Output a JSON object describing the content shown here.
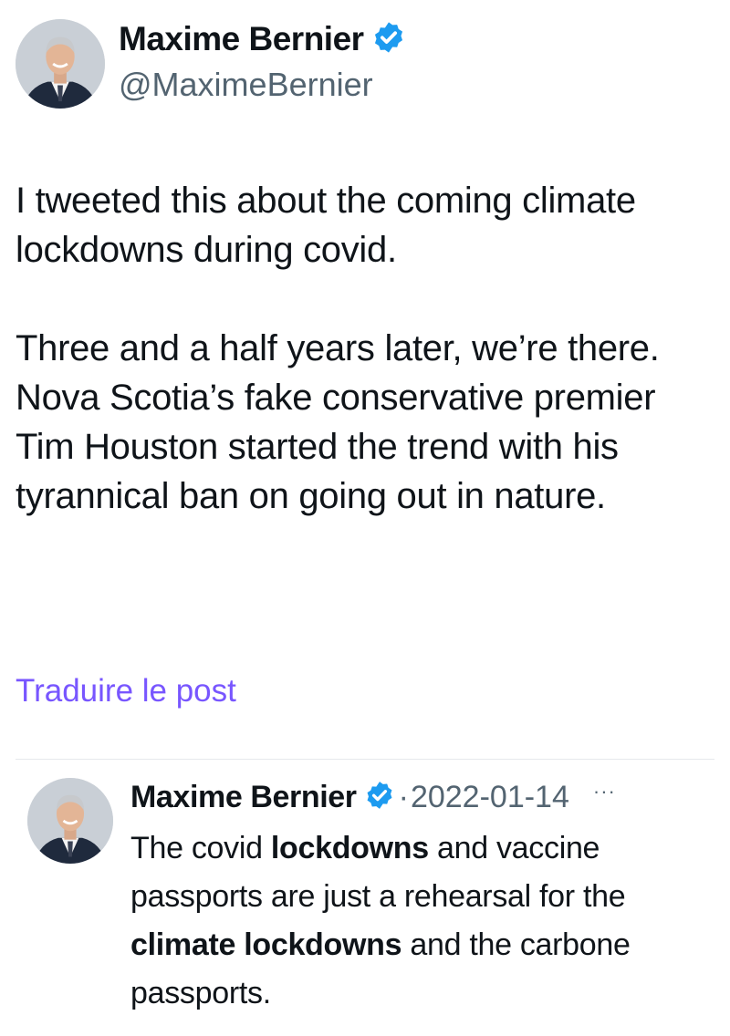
{
  "author": {
    "name": "Maxime Bernier",
    "handle": "@MaximeBernier",
    "verified_color": "#1d9bf0"
  },
  "tweet": {
    "paragraphs": [
      "I tweeted this about the coming climate lockdowns during covid.",
      "Three and a half years later, we’re there. Nova Scotia’s fake conservative premier Tim Houston started the trend with his tyrannical ban on going out in nature."
    ],
    "translate_label": "Traduire le post"
  },
  "quoted_tweet": {
    "name": "Maxime Bernier",
    "separator": "·",
    "date": "2022-01-14",
    "more_label": "···",
    "text_segments": [
      {
        "text": "The covid ",
        "bold": false
      },
      {
        "text": "lockdowns",
        "bold": true
      },
      {
        "text": " and vaccine passports are just a rehearsal for the ",
        "bold": false
      },
      {
        "text": "climate lockdowns",
        "bold": true
      },
      {
        "text": " and the carbone passports.",
        "bold": false
      }
    ]
  },
  "colors": {
    "text": "#0f1419",
    "secondary": "#536471",
    "link": "#7856ff",
    "verified": "#1d9bf0"
  },
  "icons": {
    "verified": "verified-badge-icon",
    "more": "more-horizontal-icon"
  }
}
